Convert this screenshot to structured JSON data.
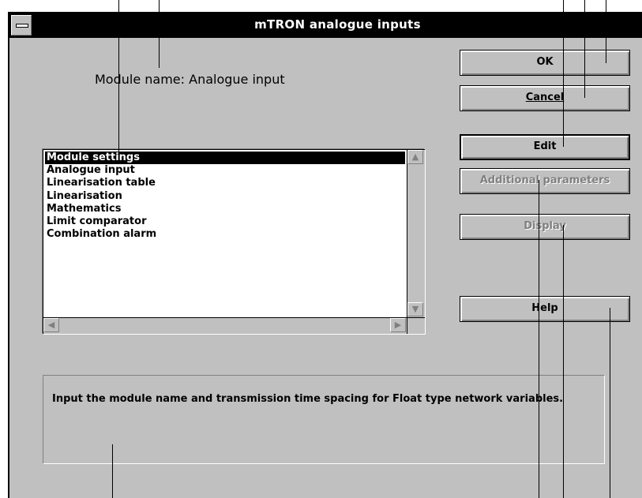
{
  "window": {
    "title": "mTRON analogue inputs"
  },
  "module_name_label": "Module name: Analogue input",
  "buttons": {
    "ok": "OK",
    "cancel": "Cancel",
    "edit": "Edit",
    "additional_parameters": "Additional parameters",
    "display": "Display",
    "help": "Help"
  },
  "list": {
    "items": [
      "Module settings",
      "Analogue input",
      "Linearisation table",
      "Linearisation",
      "Mathematics",
      "Limit comparator",
      "Combination alarm"
    ],
    "selected_index": 0
  },
  "status_text": "Input the module name and transmission time spacing for Float type network variables.",
  "colors": {
    "dialog_bg": "#c0c0c0",
    "titlebar_bg": "#000000",
    "disabled_text": "#808080"
  }
}
